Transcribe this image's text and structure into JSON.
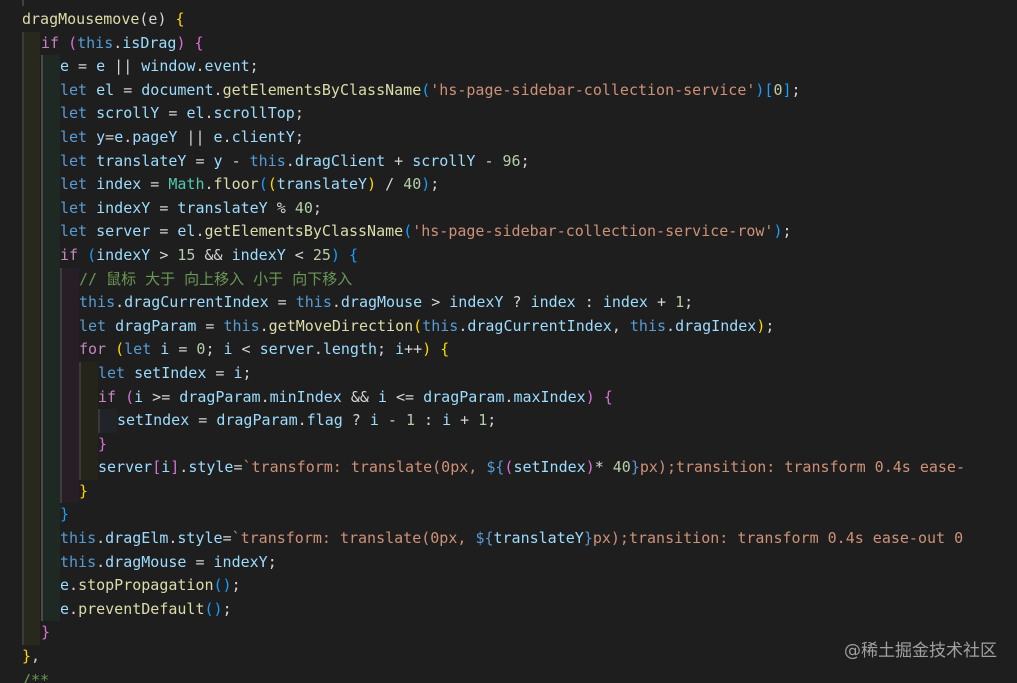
{
  "editor": {
    "watermark": "@稀土掘金技术社区",
    "lines": [
      [
        [
          "fn",
          "dragMousemove"
        ],
        [
          "plain",
          "(e) "
        ],
        [
          "brk1",
          "{"
        ]
      ],
      [
        [
          "ctrl",
          "if"
        ],
        [
          "plain",
          " "
        ],
        [
          "brk2",
          "("
        ],
        [
          "kw",
          "this"
        ],
        [
          "plain",
          "."
        ],
        [
          "var",
          "isDrag"
        ],
        [
          "brk2",
          ")"
        ],
        [
          "plain",
          " "
        ],
        [
          "brk2",
          "{"
        ]
      ],
      [
        [
          "var",
          "e"
        ],
        [
          "plain",
          " = "
        ],
        [
          "var",
          "e"
        ],
        [
          "plain",
          " || "
        ],
        [
          "var",
          "window"
        ],
        [
          "plain",
          "."
        ],
        [
          "var",
          "event"
        ],
        [
          "plain",
          ";"
        ]
      ],
      [
        [
          "kw",
          "let"
        ],
        [
          "plain",
          " "
        ],
        [
          "var",
          "el"
        ],
        [
          "plain",
          " = "
        ],
        [
          "var",
          "document"
        ],
        [
          "plain",
          "."
        ],
        [
          "fn",
          "getElementsByClassName"
        ],
        [
          "brk3",
          "("
        ],
        [
          "str",
          "'hs-page-sidebar-collection-service'"
        ],
        [
          "brk3",
          ")"
        ],
        [
          "brk3",
          "["
        ],
        [
          "num",
          "0"
        ],
        [
          "brk3",
          "]"
        ],
        [
          "plain",
          ";"
        ]
      ],
      [
        [
          "kw",
          "let"
        ],
        [
          "plain",
          " "
        ],
        [
          "var",
          "scrollY"
        ],
        [
          "plain",
          " = "
        ],
        [
          "var",
          "el"
        ],
        [
          "plain",
          "."
        ],
        [
          "var",
          "scrollTop"
        ],
        [
          "plain",
          ";"
        ]
      ],
      [
        [
          "kw",
          "let"
        ],
        [
          "plain",
          " "
        ],
        [
          "var",
          "y"
        ],
        [
          "plain",
          "="
        ],
        [
          "var",
          "e"
        ],
        [
          "plain",
          "."
        ],
        [
          "var",
          "pageY"
        ],
        [
          "plain",
          " || "
        ],
        [
          "var",
          "e"
        ],
        [
          "plain",
          "."
        ],
        [
          "var",
          "clientY"
        ],
        [
          "plain",
          ";"
        ]
      ],
      [
        [
          "kw",
          "let"
        ],
        [
          "plain",
          " "
        ],
        [
          "var",
          "translateY"
        ],
        [
          "plain",
          " = "
        ],
        [
          "var",
          "y"
        ],
        [
          "plain",
          " - "
        ],
        [
          "kw",
          "this"
        ],
        [
          "plain",
          "."
        ],
        [
          "var",
          "dragClient"
        ],
        [
          "plain",
          " + "
        ],
        [
          "var",
          "scrollY"
        ],
        [
          "plain",
          " - "
        ],
        [
          "num",
          "96"
        ],
        [
          "plain",
          ";"
        ]
      ],
      [
        [
          "kw",
          "let"
        ],
        [
          "plain",
          " "
        ],
        [
          "var",
          "index"
        ],
        [
          "plain",
          " = "
        ],
        [
          "cls",
          "Math"
        ],
        [
          "plain",
          "."
        ],
        [
          "fn",
          "floor"
        ],
        [
          "brk3",
          "("
        ],
        [
          "brk1",
          "("
        ],
        [
          "var",
          "translateY"
        ],
        [
          "brk1",
          ")"
        ],
        [
          "plain",
          " / "
        ],
        [
          "num",
          "40"
        ],
        [
          "brk3",
          ")"
        ],
        [
          "plain",
          ";"
        ]
      ],
      [
        [
          "kw",
          "let"
        ],
        [
          "plain",
          " "
        ],
        [
          "var",
          "indexY"
        ],
        [
          "plain",
          " = "
        ],
        [
          "var",
          "translateY"
        ],
        [
          "plain",
          " % "
        ],
        [
          "num",
          "40"
        ],
        [
          "plain",
          ";"
        ]
      ],
      [
        [
          "kw",
          "let"
        ],
        [
          "plain",
          " "
        ],
        [
          "var",
          "server"
        ],
        [
          "plain",
          " = "
        ],
        [
          "var",
          "el"
        ],
        [
          "plain",
          "."
        ],
        [
          "fn",
          "getElementsByClassName"
        ],
        [
          "brk3",
          "("
        ],
        [
          "str",
          "'hs-page-sidebar-collection-service-row'"
        ],
        [
          "brk3",
          ")"
        ],
        [
          "plain",
          ";"
        ]
      ],
      [
        [
          "ctrl",
          "if"
        ],
        [
          "plain",
          " "
        ],
        [
          "brk3",
          "("
        ],
        [
          "var",
          "indexY"
        ],
        [
          "plain",
          " > "
        ],
        [
          "num",
          "15"
        ],
        [
          "plain",
          " && "
        ],
        [
          "var",
          "indexY"
        ],
        [
          "plain",
          " < "
        ],
        [
          "num",
          "25"
        ],
        [
          "brk3",
          ")"
        ],
        [
          "plain",
          " "
        ],
        [
          "brk3",
          "{"
        ]
      ],
      [
        [
          "cmt",
          "// 鼠标 大于 向上移入 小于 向下移入"
        ]
      ],
      [
        [
          "kw",
          "this"
        ],
        [
          "plain",
          "."
        ],
        [
          "var",
          "dragCurrentIndex"
        ],
        [
          "plain",
          " = "
        ],
        [
          "kw",
          "this"
        ],
        [
          "plain",
          "."
        ],
        [
          "var",
          "dragMouse"
        ],
        [
          "plain",
          " > "
        ],
        [
          "var",
          "indexY"
        ],
        [
          "plain",
          " ? "
        ],
        [
          "var",
          "index"
        ],
        [
          "plain",
          " : "
        ],
        [
          "var",
          "index"
        ],
        [
          "plain",
          " + "
        ],
        [
          "num",
          "1"
        ],
        [
          "plain",
          ";"
        ]
      ],
      [
        [
          "kw",
          "let"
        ],
        [
          "plain",
          " "
        ],
        [
          "var",
          "dragParam"
        ],
        [
          "plain",
          " = "
        ],
        [
          "kw",
          "this"
        ],
        [
          "plain",
          "."
        ],
        [
          "fn",
          "getMoveDirection"
        ],
        [
          "brk1",
          "("
        ],
        [
          "kw",
          "this"
        ],
        [
          "plain",
          "."
        ],
        [
          "var",
          "dragCurrentIndex"
        ],
        [
          "plain",
          ", "
        ],
        [
          "kw",
          "this"
        ],
        [
          "plain",
          "."
        ],
        [
          "var",
          "dragIndex"
        ],
        [
          "brk1",
          ")"
        ],
        [
          "plain",
          ";"
        ]
      ],
      [
        [
          "ctrl",
          "for"
        ],
        [
          "plain",
          " "
        ],
        [
          "brk1",
          "("
        ],
        [
          "kw",
          "let"
        ],
        [
          "plain",
          " "
        ],
        [
          "var",
          "i"
        ],
        [
          "plain",
          " = "
        ],
        [
          "num",
          "0"
        ],
        [
          "plain",
          "; "
        ],
        [
          "var",
          "i"
        ],
        [
          "plain",
          " < "
        ],
        [
          "var",
          "server"
        ],
        [
          "plain",
          "."
        ],
        [
          "var",
          "length"
        ],
        [
          "plain",
          "; "
        ],
        [
          "var",
          "i"
        ],
        [
          "plain",
          "++"
        ],
        [
          "brk1",
          ")"
        ],
        [
          "plain",
          " "
        ],
        [
          "brk1",
          "{"
        ]
      ],
      [
        [
          "kw",
          "let"
        ],
        [
          "plain",
          " "
        ],
        [
          "var",
          "setIndex"
        ],
        [
          "plain",
          " = "
        ],
        [
          "var",
          "i"
        ],
        [
          "plain",
          ";"
        ]
      ],
      [
        [
          "ctrl",
          "if"
        ],
        [
          "plain",
          " "
        ],
        [
          "brk2",
          "("
        ],
        [
          "var",
          "i"
        ],
        [
          "plain",
          " >= "
        ],
        [
          "var",
          "dragParam"
        ],
        [
          "plain",
          "."
        ],
        [
          "var",
          "minIndex"
        ],
        [
          "plain",
          " && "
        ],
        [
          "var",
          "i"
        ],
        [
          "plain",
          " <= "
        ],
        [
          "var",
          "dragParam"
        ],
        [
          "plain",
          "."
        ],
        [
          "var",
          "maxIndex"
        ],
        [
          "brk2",
          ")"
        ],
        [
          "plain",
          " "
        ],
        [
          "brk2",
          "{"
        ]
      ],
      [
        [
          "var",
          "setIndex"
        ],
        [
          "plain",
          " = "
        ],
        [
          "var",
          "dragParam"
        ],
        [
          "plain",
          "."
        ],
        [
          "var",
          "flag"
        ],
        [
          "plain",
          " ? "
        ],
        [
          "var",
          "i"
        ],
        [
          "plain",
          " - "
        ],
        [
          "num",
          "1"
        ],
        [
          "plain",
          " : "
        ],
        [
          "var",
          "i"
        ],
        [
          "plain",
          " + "
        ],
        [
          "num",
          "1"
        ],
        [
          "plain",
          ";"
        ]
      ],
      [
        [
          "brk2",
          "}"
        ]
      ],
      [
        [
          "var",
          "server"
        ],
        [
          "brk2",
          "["
        ],
        [
          "var",
          "i"
        ],
        [
          "brk2",
          "]"
        ],
        [
          "plain",
          "."
        ],
        [
          "var",
          "style"
        ],
        [
          "plain",
          "="
        ],
        [
          "str",
          "`transform: translate(0px, "
        ],
        [
          "kw",
          "${"
        ],
        [
          "brk2",
          "("
        ],
        [
          "var",
          "setIndex"
        ],
        [
          "brk2",
          ")"
        ],
        [
          "plain",
          "* "
        ],
        [
          "num",
          "40"
        ],
        [
          "kw",
          "}"
        ],
        [
          "str",
          "px);transition: transform 0.4s ease-"
        ]
      ],
      [
        [
          "brk1",
          "}"
        ]
      ],
      [
        [
          "brk3",
          "}"
        ]
      ],
      [
        [
          "kw",
          "this"
        ],
        [
          "plain",
          "."
        ],
        [
          "var",
          "dragElm"
        ],
        [
          "plain",
          "."
        ],
        [
          "var",
          "style"
        ],
        [
          "plain",
          "="
        ],
        [
          "str",
          "`transform: translate(0px, "
        ],
        [
          "kw",
          "${"
        ],
        [
          "var",
          "translateY"
        ],
        [
          "kw",
          "}"
        ],
        [
          "str",
          "px);transition: transform 0.4s ease-out 0"
        ]
      ],
      [
        [
          "kw",
          "this"
        ],
        [
          "plain",
          "."
        ],
        [
          "var",
          "dragMouse"
        ],
        [
          "plain",
          " = "
        ],
        [
          "var",
          "indexY"
        ],
        [
          "plain",
          ";"
        ]
      ],
      [
        [
          "var",
          "e"
        ],
        [
          "plain",
          "."
        ],
        [
          "fn",
          "stopPropagation"
        ],
        [
          "brk3",
          "()"
        ],
        [
          "plain",
          ";"
        ]
      ],
      [
        [
          "var",
          "e"
        ],
        [
          "plain",
          "."
        ],
        [
          "fn",
          "preventDefault"
        ],
        [
          "brk3",
          "()"
        ],
        [
          "plain",
          ";"
        ]
      ],
      [
        [
          "brk2",
          "}"
        ]
      ],
      [
        [
          "brk1",
          "}"
        ],
        [
          "plain",
          ","
        ]
      ],
      [
        [
          "cmt",
          "/**"
        ]
      ]
    ]
  }
}
